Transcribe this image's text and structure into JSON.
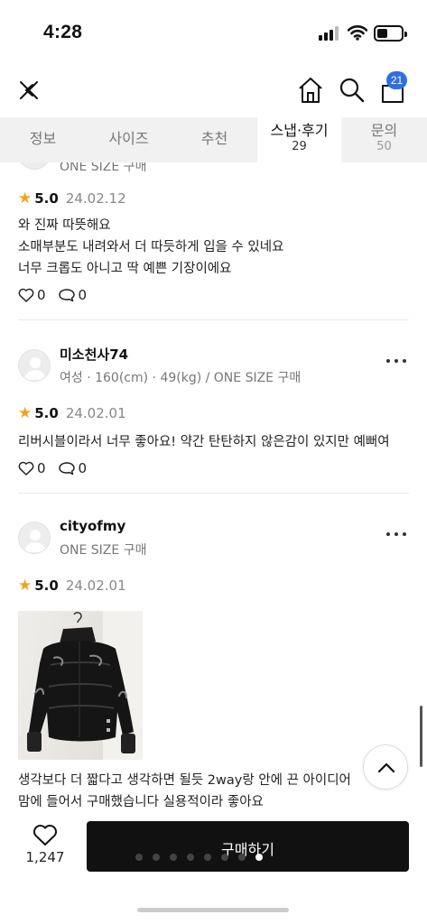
{
  "status_bar": {
    "time": "4:28"
  },
  "nav": {
    "cart_badge": "21"
  },
  "tabs": [
    {
      "label": "정보"
    },
    {
      "label": "사이즈"
    },
    {
      "label": "추천"
    },
    {
      "label": "스냅·후기",
      "count": "29"
    },
    {
      "label": "문의",
      "count": "50"
    }
  ],
  "reviews": [
    {
      "meta": "ONE SIZE 구매",
      "rating": "5.0",
      "date": "24.02.12",
      "lines": [
        "와 진짜 따뜻해요",
        "소매부분도 내려와서 더 따듯하게 입을 수 있네요",
        "너무 크롭도 아니고 딱 예쁜 기장이에요"
      ],
      "likes": "0",
      "comments": "0"
    },
    {
      "name": "미소천사74",
      "meta": "여성 · 160(cm) · 49(kg)   /   ONE SIZE 구매",
      "rating": "5.0",
      "date": "24.02.01",
      "lines": [
        "리버시블이라서 너무 좋아요! 약간 탄탄하지 않은감이 있지만 예뻐여"
      ],
      "likes": "0",
      "comments": "0"
    },
    {
      "name": "cityofmy",
      "meta": "ONE SIZE 구매",
      "rating": "5.0",
      "date": "24.02.01",
      "lines": [
        "생각보다 더 짧다고 생각하면 될듯 2way랑 안에 끈 아이디어",
        "맘에 들어서 구매했습니다 실용적이라 좋아요"
      ]
    }
  ],
  "bottom": {
    "like_count": "1,247",
    "buy_label": "구매하기",
    "carousel": {
      "pages": 8,
      "current": 8
    }
  },
  "colors": {
    "star": "#f0a41a",
    "badge": "#2f6fe0",
    "button": "#111111"
  }
}
